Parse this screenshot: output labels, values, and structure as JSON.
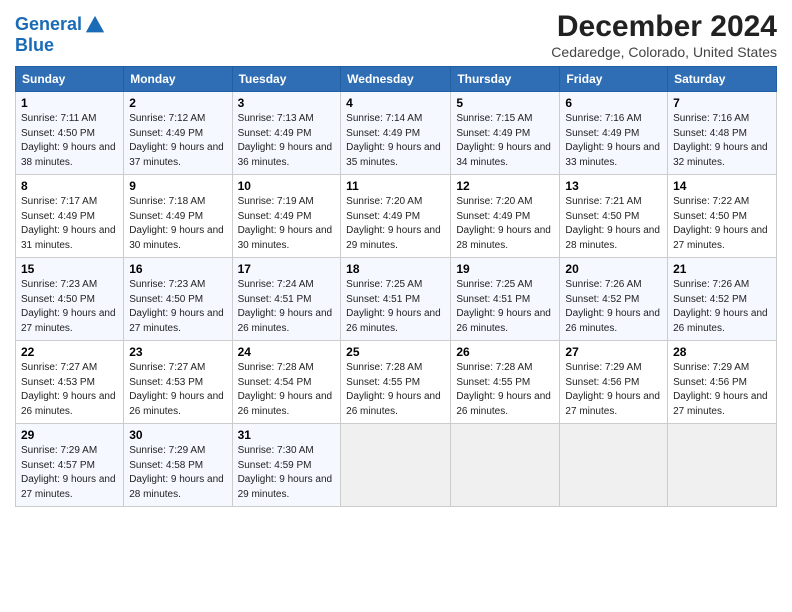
{
  "header": {
    "logo_line1": "General",
    "logo_line2": "Blue",
    "title": "December 2024",
    "subtitle": "Cedaredge, Colorado, United States"
  },
  "days_of_week": [
    "Sunday",
    "Monday",
    "Tuesday",
    "Wednesday",
    "Thursday",
    "Friday",
    "Saturday"
  ],
  "weeks": [
    [
      {
        "day": "1",
        "sunrise": "7:11 AM",
        "sunset": "4:50 PM",
        "daylight": "9 hours and 38 minutes."
      },
      {
        "day": "2",
        "sunrise": "7:12 AM",
        "sunset": "4:49 PM",
        "daylight": "9 hours and 37 minutes."
      },
      {
        "day": "3",
        "sunrise": "7:13 AM",
        "sunset": "4:49 PM",
        "daylight": "9 hours and 36 minutes."
      },
      {
        "day": "4",
        "sunrise": "7:14 AM",
        "sunset": "4:49 PM",
        "daylight": "9 hours and 35 minutes."
      },
      {
        "day": "5",
        "sunrise": "7:15 AM",
        "sunset": "4:49 PM",
        "daylight": "9 hours and 34 minutes."
      },
      {
        "day": "6",
        "sunrise": "7:16 AM",
        "sunset": "4:49 PM",
        "daylight": "9 hours and 33 minutes."
      },
      {
        "day": "7",
        "sunrise": "7:16 AM",
        "sunset": "4:48 PM",
        "daylight": "9 hours and 32 minutes."
      }
    ],
    [
      {
        "day": "8",
        "sunrise": "7:17 AM",
        "sunset": "4:49 PM",
        "daylight": "9 hours and 31 minutes."
      },
      {
        "day": "9",
        "sunrise": "7:18 AM",
        "sunset": "4:49 PM",
        "daylight": "9 hours and 30 minutes."
      },
      {
        "day": "10",
        "sunrise": "7:19 AM",
        "sunset": "4:49 PM",
        "daylight": "9 hours and 30 minutes."
      },
      {
        "day": "11",
        "sunrise": "7:20 AM",
        "sunset": "4:49 PM",
        "daylight": "9 hours and 29 minutes."
      },
      {
        "day": "12",
        "sunrise": "7:20 AM",
        "sunset": "4:49 PM",
        "daylight": "9 hours and 28 minutes."
      },
      {
        "day": "13",
        "sunrise": "7:21 AM",
        "sunset": "4:50 PM",
        "daylight": "9 hours and 28 minutes."
      },
      {
        "day": "14",
        "sunrise": "7:22 AM",
        "sunset": "4:50 PM",
        "daylight": "9 hours and 27 minutes."
      }
    ],
    [
      {
        "day": "15",
        "sunrise": "7:23 AM",
        "sunset": "4:50 PM",
        "daylight": "9 hours and 27 minutes."
      },
      {
        "day": "16",
        "sunrise": "7:23 AM",
        "sunset": "4:50 PM",
        "daylight": "9 hours and 27 minutes."
      },
      {
        "day": "17",
        "sunrise": "7:24 AM",
        "sunset": "4:51 PM",
        "daylight": "9 hours and 26 minutes."
      },
      {
        "day": "18",
        "sunrise": "7:25 AM",
        "sunset": "4:51 PM",
        "daylight": "9 hours and 26 minutes."
      },
      {
        "day": "19",
        "sunrise": "7:25 AM",
        "sunset": "4:51 PM",
        "daylight": "9 hours and 26 minutes."
      },
      {
        "day": "20",
        "sunrise": "7:26 AM",
        "sunset": "4:52 PM",
        "daylight": "9 hours and 26 minutes."
      },
      {
        "day": "21",
        "sunrise": "7:26 AM",
        "sunset": "4:52 PM",
        "daylight": "9 hours and 26 minutes."
      }
    ],
    [
      {
        "day": "22",
        "sunrise": "7:27 AM",
        "sunset": "4:53 PM",
        "daylight": "9 hours and 26 minutes."
      },
      {
        "day": "23",
        "sunrise": "7:27 AM",
        "sunset": "4:53 PM",
        "daylight": "9 hours and 26 minutes."
      },
      {
        "day": "24",
        "sunrise": "7:28 AM",
        "sunset": "4:54 PM",
        "daylight": "9 hours and 26 minutes."
      },
      {
        "day": "25",
        "sunrise": "7:28 AM",
        "sunset": "4:55 PM",
        "daylight": "9 hours and 26 minutes."
      },
      {
        "day": "26",
        "sunrise": "7:28 AM",
        "sunset": "4:55 PM",
        "daylight": "9 hours and 26 minutes."
      },
      {
        "day": "27",
        "sunrise": "7:29 AM",
        "sunset": "4:56 PM",
        "daylight": "9 hours and 27 minutes."
      },
      {
        "day": "28",
        "sunrise": "7:29 AM",
        "sunset": "4:56 PM",
        "daylight": "9 hours and 27 minutes."
      }
    ],
    [
      {
        "day": "29",
        "sunrise": "7:29 AM",
        "sunset": "4:57 PM",
        "daylight": "9 hours and 27 minutes."
      },
      {
        "day": "30",
        "sunrise": "7:29 AM",
        "sunset": "4:58 PM",
        "daylight": "9 hours and 28 minutes."
      },
      {
        "day": "31",
        "sunrise": "7:30 AM",
        "sunset": "4:59 PM",
        "daylight": "9 hours and 29 minutes."
      },
      null,
      null,
      null,
      null
    ]
  ]
}
